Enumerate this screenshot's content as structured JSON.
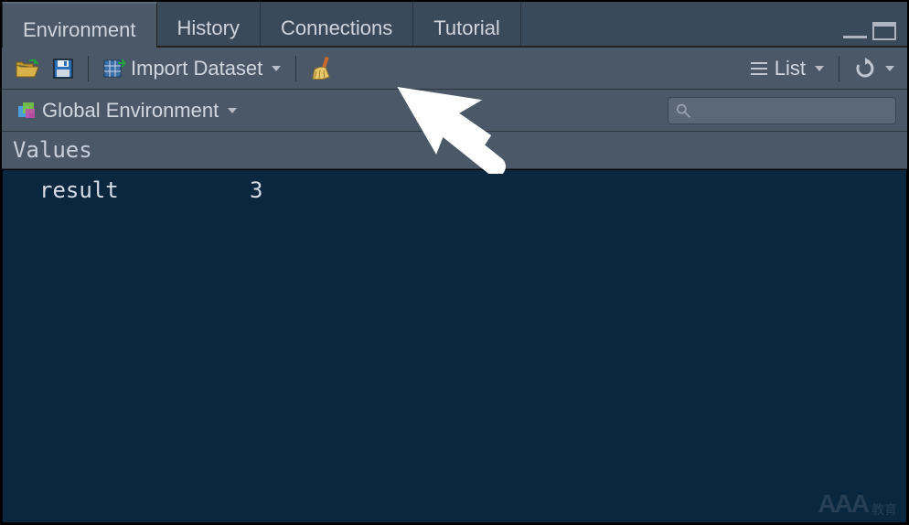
{
  "tabs": {
    "environment": "Environment",
    "history": "History",
    "connections": "Connections",
    "tutorial": "Tutorial"
  },
  "toolbar": {
    "import_dataset_label": "Import Dataset",
    "view_mode_label": "List"
  },
  "scope": {
    "label": "Global Environment"
  },
  "search": {
    "placeholder": ""
  },
  "section": {
    "values_header": "Values"
  },
  "vars": {
    "row0": {
      "name": "result",
      "value": "3"
    }
  },
  "watermark": {
    "main": "AAA",
    "sub": "教育"
  }
}
